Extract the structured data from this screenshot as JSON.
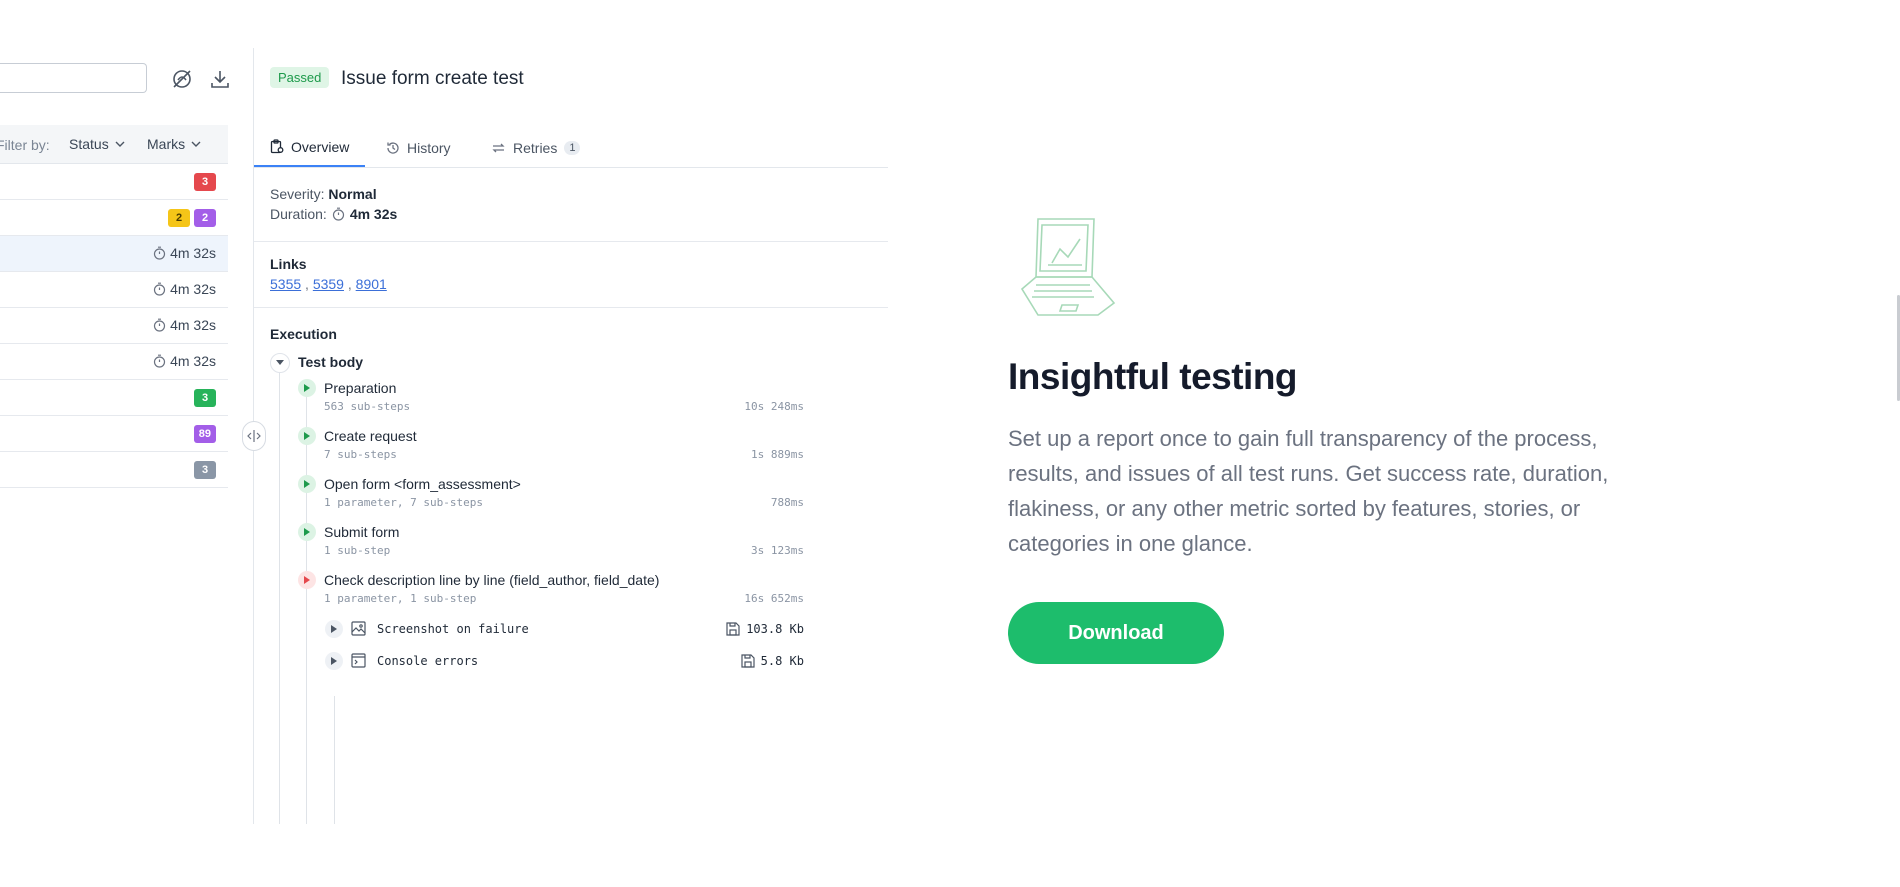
{
  "left": {
    "filter_label": "Filter by:",
    "status_dropdown": "Status",
    "marks_dropdown": "Marks",
    "rows": [
      {
        "badges": [
          {
            "text": "3",
            "color": "red"
          }
        ]
      },
      {
        "badges": [
          {
            "text": "2",
            "color": "yellow"
          },
          {
            "text": "2",
            "color": "purple"
          }
        ]
      },
      {
        "duration": "4m 32s",
        "selected": true
      },
      {
        "duration": "4m 32s"
      },
      {
        "duration": "4m 32s"
      },
      {
        "duration": "4m 32s"
      },
      {
        "badges": [
          {
            "text": "3",
            "color": "green"
          }
        ]
      },
      {
        "badges": [
          {
            "text": "89",
            "color": "purple"
          }
        ]
      },
      {
        "badges": [
          {
            "text": "3",
            "color": "gray"
          }
        ]
      }
    ]
  },
  "detail": {
    "status": "Passed",
    "title": "Issue form create test",
    "tabs": [
      {
        "label": "Overview",
        "active": true
      },
      {
        "label": "History"
      },
      {
        "label": "Retries",
        "count": "1"
      }
    ],
    "severity_label": "Severity:",
    "severity_value": "Normal",
    "duration_label": "Duration:",
    "duration_value": "4m 32s",
    "links_heading": "Links",
    "links": [
      "5355",
      "5359",
      "8901"
    ],
    "execution_heading": "Execution",
    "test_body_label": "Test body",
    "steps": [
      {
        "name": "Preparation",
        "sub": "563 sub-steps",
        "time": "10s 248ms",
        "status": "passed"
      },
      {
        "name": "Create request",
        "sub": "7 sub-steps",
        "time": "1s 889ms",
        "status": "passed"
      },
      {
        "name": "Open form <form_assessment>",
        "sub": "1 parameter, 7 sub-steps",
        "time": "788ms",
        "status": "passed"
      },
      {
        "name": "Submit form",
        "sub": "1 sub-step",
        "time": "3s 123ms",
        "status": "passed"
      },
      {
        "name": "Check description line by line (field_author, field_date)",
        "sub": "1 parameter, 1 sub-step",
        "time": "16s 652ms",
        "status": "failed"
      }
    ],
    "attachments": [
      {
        "name": "Screenshot on failure",
        "size": "103.8 Kb",
        "icon": "image-icon"
      },
      {
        "name": "Console errors",
        "size": "5.8 Kb",
        "icon": "console-icon"
      }
    ]
  },
  "promo": {
    "title": "Insightful testing",
    "body": "Set up a report once to gain full transparency of the process, results, and issues of all test runs. Get success rate, duration, flakiness, or any other metric sorted by features, stories, or categories in one glance.",
    "button": "Download"
  },
  "colors": {
    "accent_green": "#1dbd6c",
    "passed_bg": "#dff5e6",
    "failed": "#e5484d",
    "tab_underline": "#3b82f6"
  }
}
